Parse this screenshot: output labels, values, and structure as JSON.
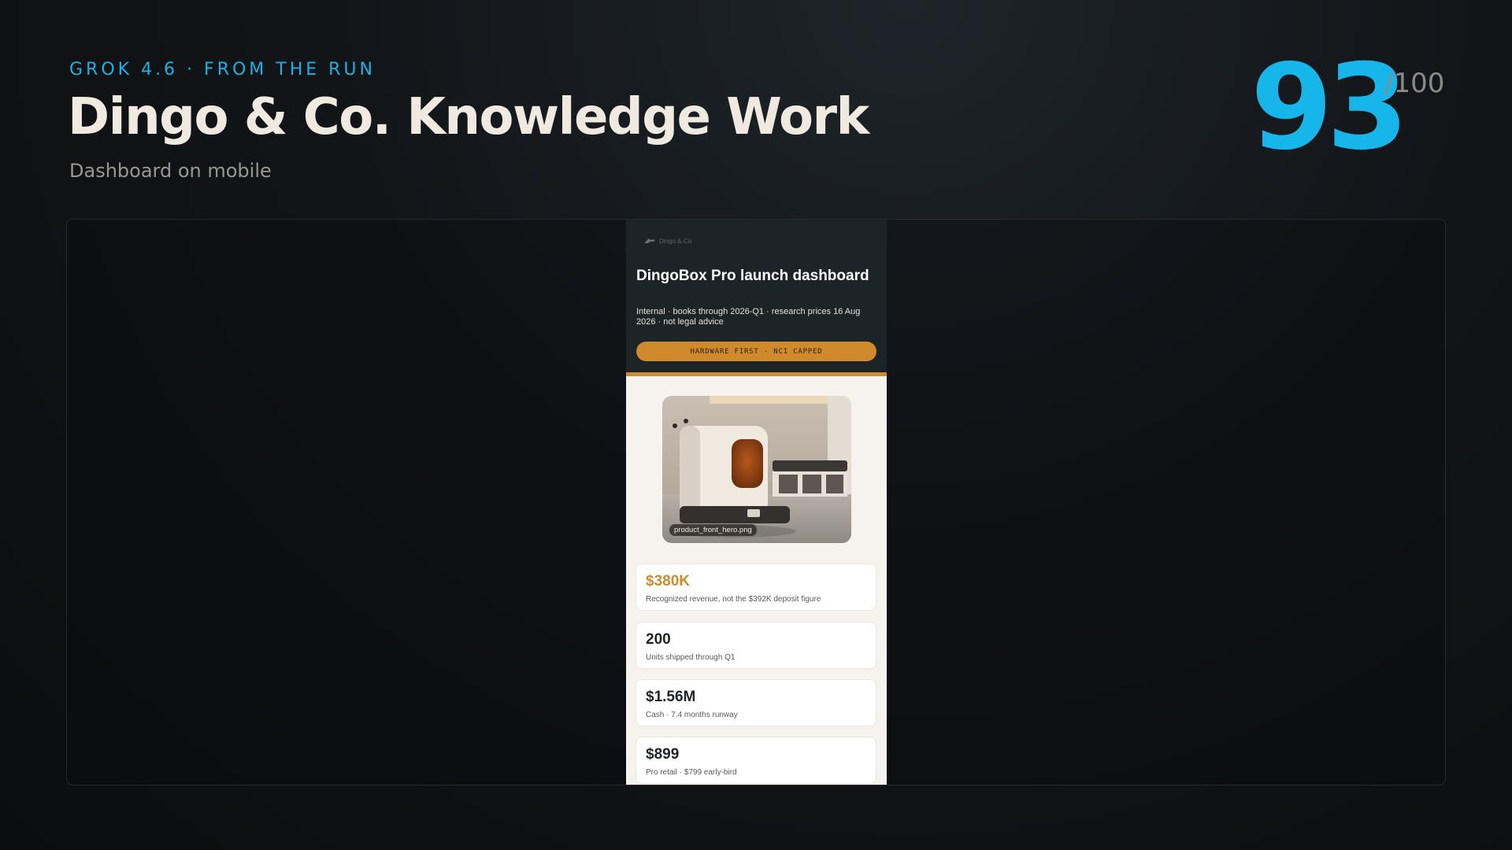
{
  "header": {
    "eyebrow": "GROK 4.6 · FROM THE RUN",
    "title": "Dingo & Co. Knowledge Work",
    "subtitle": "Dashboard on mobile"
  },
  "score": {
    "value": "93",
    "max": "/100"
  },
  "colors": {
    "accent": "#17b6ea",
    "brand_orange": "#d08a2c",
    "header_bg": "#1c2428",
    "page_bg": "#f6f3ee"
  },
  "phone": {
    "brand": {
      "name": "Dingo & Co.",
      "icon": "dingo-logo-icon"
    },
    "dashboard_title": "DingoBox Pro launch dashboard",
    "dashboard_subtitle": "Internal · books through 2026-Q1 · research prices 16 Aug 2026 · not legal advice",
    "pill_label": "HARDWARE FIRST · NCI CAPPED",
    "hero_caption": "product_front_hero.png",
    "stats": [
      {
        "value": "$380K",
        "label": "Recognized revenue, not the $392K deposit figure"
      },
      {
        "value": "200",
        "label": "Units shipped through Q1"
      },
      {
        "value": "$1.56M",
        "label": "Cash · 7.4 months runway"
      },
      {
        "value": "$899",
        "label": "Pro retail · $799 early-bird"
      }
    ]
  }
}
